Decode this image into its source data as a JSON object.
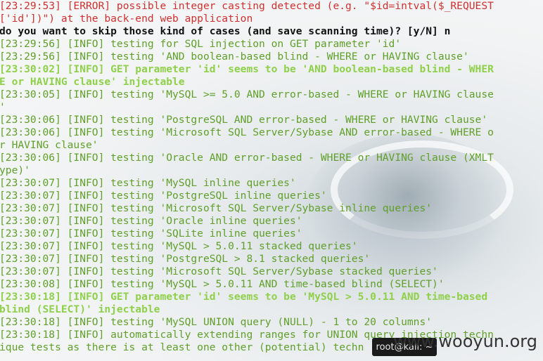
{
  "window": {
    "taskbar_label": "root@kali: ~"
  },
  "watermark": "www.wooyun.org",
  "colors": {
    "error": "#d03030",
    "info": "#5f9f2a",
    "highlight": "#8fd04a",
    "prompt": "#111111"
  },
  "terminal_lines": [
    {
      "style": "error",
      "text": "[23:29:53] [ERROR] possible integer casting detected (e.g. \"$id=intval($_REQUEST"
    },
    {
      "style": "error",
      "text": "['id'])\") at the back-end web application"
    },
    {
      "style": "prompt",
      "text": "do you want to skip those kind of cases (and save scanning time)? [y/N] n"
    },
    {
      "style": "info",
      "text": "[23:29:56] [INFO] testing for SQL injection on GET parameter 'id'"
    },
    {
      "style": "info",
      "text": "[23:29:56] [INFO] testing 'AND boolean-based blind - WHERE or HAVING clause'"
    },
    {
      "style": "hl",
      "text": "[23:30:02] [INFO] GET parameter 'id' seems to be 'AND boolean-based blind - WHER"
    },
    {
      "style": "hl",
      "text": "E or HAVING clause' injectable"
    },
    {
      "style": "info",
      "text": "[23:30:05] [INFO] testing 'MySQL >= 5.0 AND error-based - WHERE or HAVING clause"
    },
    {
      "style": "info",
      "text": "'"
    },
    {
      "style": "info",
      "text": "[23:30:06] [INFO] testing 'PostgreSQL AND error-based - WHERE or HAVING clause'"
    },
    {
      "style": "info",
      "text": "[23:30:06] [INFO] testing 'Microsoft SQL Server/Sybase AND error-based - WHERE o"
    },
    {
      "style": "info",
      "text": "r HAVING clause'"
    },
    {
      "style": "info",
      "text": "[23:30:06] [INFO] testing 'Oracle AND error-based - WHERE or HAVING clause (XMLT"
    },
    {
      "style": "info",
      "text": "ype)'"
    },
    {
      "style": "info",
      "text": "[23:30:07] [INFO] testing 'MySQL inline queries'"
    },
    {
      "style": "info",
      "text": "[23:30:07] [INFO] testing 'PostgreSQL inline queries'"
    },
    {
      "style": "info",
      "text": "[23:30:07] [INFO] testing 'Microsoft SQL Server/Sybase inline queries'"
    },
    {
      "style": "info",
      "text": "[23:30:07] [INFO] testing 'Oracle inline queries'"
    },
    {
      "style": "info",
      "text": "[23:30:07] [INFO] testing 'SQLite inline queries'"
    },
    {
      "style": "info",
      "text": "[23:30:07] [INFO] testing 'MySQL > 5.0.11 stacked queries'"
    },
    {
      "style": "info",
      "text": "[23:30:07] [INFO] testing 'PostgreSQL > 8.1 stacked queries'"
    },
    {
      "style": "info",
      "text": "[23:30:07] [INFO] testing 'Microsoft SQL Server/Sybase stacked queries'"
    },
    {
      "style": "info",
      "text": "[23:30:08] [INFO] testing 'MySQL > 5.0.11 AND time-based blind (SELECT)'"
    },
    {
      "style": "hl",
      "text": "[23:30:18] [INFO] GET parameter 'id' seems to be 'MySQL > 5.0.11 AND time-based"
    },
    {
      "style": "hl",
      "text": "blind (SELECT)' injectable"
    },
    {
      "style": "info",
      "text": "[23:30:18] [INFO] testing 'MySQL UNION query (NULL) - 1 to 20 columns'"
    },
    {
      "style": "info",
      "text": "[23:30:18] [INFO] automatically extending ranges for UNION query injection techn"
    },
    {
      "style": "info",
      "text": "ique tests as there is at least one other (potential) techn"
    }
  ]
}
